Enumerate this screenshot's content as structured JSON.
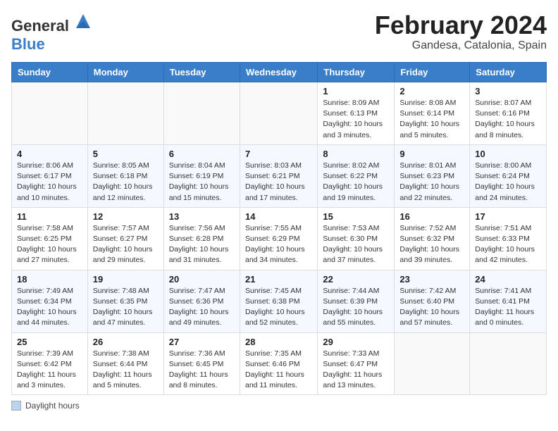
{
  "header": {
    "logo_general": "General",
    "logo_blue": "Blue",
    "month_title": "February 2024",
    "location": "Gandesa, Catalonia, Spain"
  },
  "days_of_week": [
    "Sunday",
    "Monday",
    "Tuesday",
    "Wednesday",
    "Thursday",
    "Friday",
    "Saturday"
  ],
  "legend_label": "Daylight hours",
  "weeks": [
    [
      {
        "num": "",
        "detail": ""
      },
      {
        "num": "",
        "detail": ""
      },
      {
        "num": "",
        "detail": ""
      },
      {
        "num": "",
        "detail": ""
      },
      {
        "num": "1",
        "detail": "Sunrise: 8:09 AM\nSunset: 6:13 PM\nDaylight: 10 hours\nand 3 minutes."
      },
      {
        "num": "2",
        "detail": "Sunrise: 8:08 AM\nSunset: 6:14 PM\nDaylight: 10 hours\nand 5 minutes."
      },
      {
        "num": "3",
        "detail": "Sunrise: 8:07 AM\nSunset: 6:16 PM\nDaylight: 10 hours\nand 8 minutes."
      }
    ],
    [
      {
        "num": "4",
        "detail": "Sunrise: 8:06 AM\nSunset: 6:17 PM\nDaylight: 10 hours\nand 10 minutes."
      },
      {
        "num": "5",
        "detail": "Sunrise: 8:05 AM\nSunset: 6:18 PM\nDaylight: 10 hours\nand 12 minutes."
      },
      {
        "num": "6",
        "detail": "Sunrise: 8:04 AM\nSunset: 6:19 PM\nDaylight: 10 hours\nand 15 minutes."
      },
      {
        "num": "7",
        "detail": "Sunrise: 8:03 AM\nSunset: 6:21 PM\nDaylight: 10 hours\nand 17 minutes."
      },
      {
        "num": "8",
        "detail": "Sunrise: 8:02 AM\nSunset: 6:22 PM\nDaylight: 10 hours\nand 19 minutes."
      },
      {
        "num": "9",
        "detail": "Sunrise: 8:01 AM\nSunset: 6:23 PM\nDaylight: 10 hours\nand 22 minutes."
      },
      {
        "num": "10",
        "detail": "Sunrise: 8:00 AM\nSunset: 6:24 PM\nDaylight: 10 hours\nand 24 minutes."
      }
    ],
    [
      {
        "num": "11",
        "detail": "Sunrise: 7:58 AM\nSunset: 6:25 PM\nDaylight: 10 hours\nand 27 minutes."
      },
      {
        "num": "12",
        "detail": "Sunrise: 7:57 AM\nSunset: 6:27 PM\nDaylight: 10 hours\nand 29 minutes."
      },
      {
        "num": "13",
        "detail": "Sunrise: 7:56 AM\nSunset: 6:28 PM\nDaylight: 10 hours\nand 31 minutes."
      },
      {
        "num": "14",
        "detail": "Sunrise: 7:55 AM\nSunset: 6:29 PM\nDaylight: 10 hours\nand 34 minutes."
      },
      {
        "num": "15",
        "detail": "Sunrise: 7:53 AM\nSunset: 6:30 PM\nDaylight: 10 hours\nand 37 minutes."
      },
      {
        "num": "16",
        "detail": "Sunrise: 7:52 AM\nSunset: 6:32 PM\nDaylight: 10 hours\nand 39 minutes."
      },
      {
        "num": "17",
        "detail": "Sunrise: 7:51 AM\nSunset: 6:33 PM\nDaylight: 10 hours\nand 42 minutes."
      }
    ],
    [
      {
        "num": "18",
        "detail": "Sunrise: 7:49 AM\nSunset: 6:34 PM\nDaylight: 10 hours\nand 44 minutes."
      },
      {
        "num": "19",
        "detail": "Sunrise: 7:48 AM\nSunset: 6:35 PM\nDaylight: 10 hours\nand 47 minutes."
      },
      {
        "num": "20",
        "detail": "Sunrise: 7:47 AM\nSunset: 6:36 PM\nDaylight: 10 hours\nand 49 minutes."
      },
      {
        "num": "21",
        "detail": "Sunrise: 7:45 AM\nSunset: 6:38 PM\nDaylight: 10 hours\nand 52 minutes."
      },
      {
        "num": "22",
        "detail": "Sunrise: 7:44 AM\nSunset: 6:39 PM\nDaylight: 10 hours\nand 55 minutes."
      },
      {
        "num": "23",
        "detail": "Sunrise: 7:42 AM\nSunset: 6:40 PM\nDaylight: 10 hours\nand 57 minutes."
      },
      {
        "num": "24",
        "detail": "Sunrise: 7:41 AM\nSunset: 6:41 PM\nDaylight: 11 hours\nand 0 minutes."
      }
    ],
    [
      {
        "num": "25",
        "detail": "Sunrise: 7:39 AM\nSunset: 6:42 PM\nDaylight: 11 hours\nand 3 minutes."
      },
      {
        "num": "26",
        "detail": "Sunrise: 7:38 AM\nSunset: 6:44 PM\nDaylight: 11 hours\nand 5 minutes."
      },
      {
        "num": "27",
        "detail": "Sunrise: 7:36 AM\nSunset: 6:45 PM\nDaylight: 11 hours\nand 8 minutes."
      },
      {
        "num": "28",
        "detail": "Sunrise: 7:35 AM\nSunset: 6:46 PM\nDaylight: 11 hours\nand 11 minutes."
      },
      {
        "num": "29",
        "detail": "Sunrise: 7:33 AM\nSunset: 6:47 PM\nDaylight: 11 hours\nand 13 minutes."
      },
      {
        "num": "",
        "detail": ""
      },
      {
        "num": "",
        "detail": ""
      }
    ]
  ]
}
